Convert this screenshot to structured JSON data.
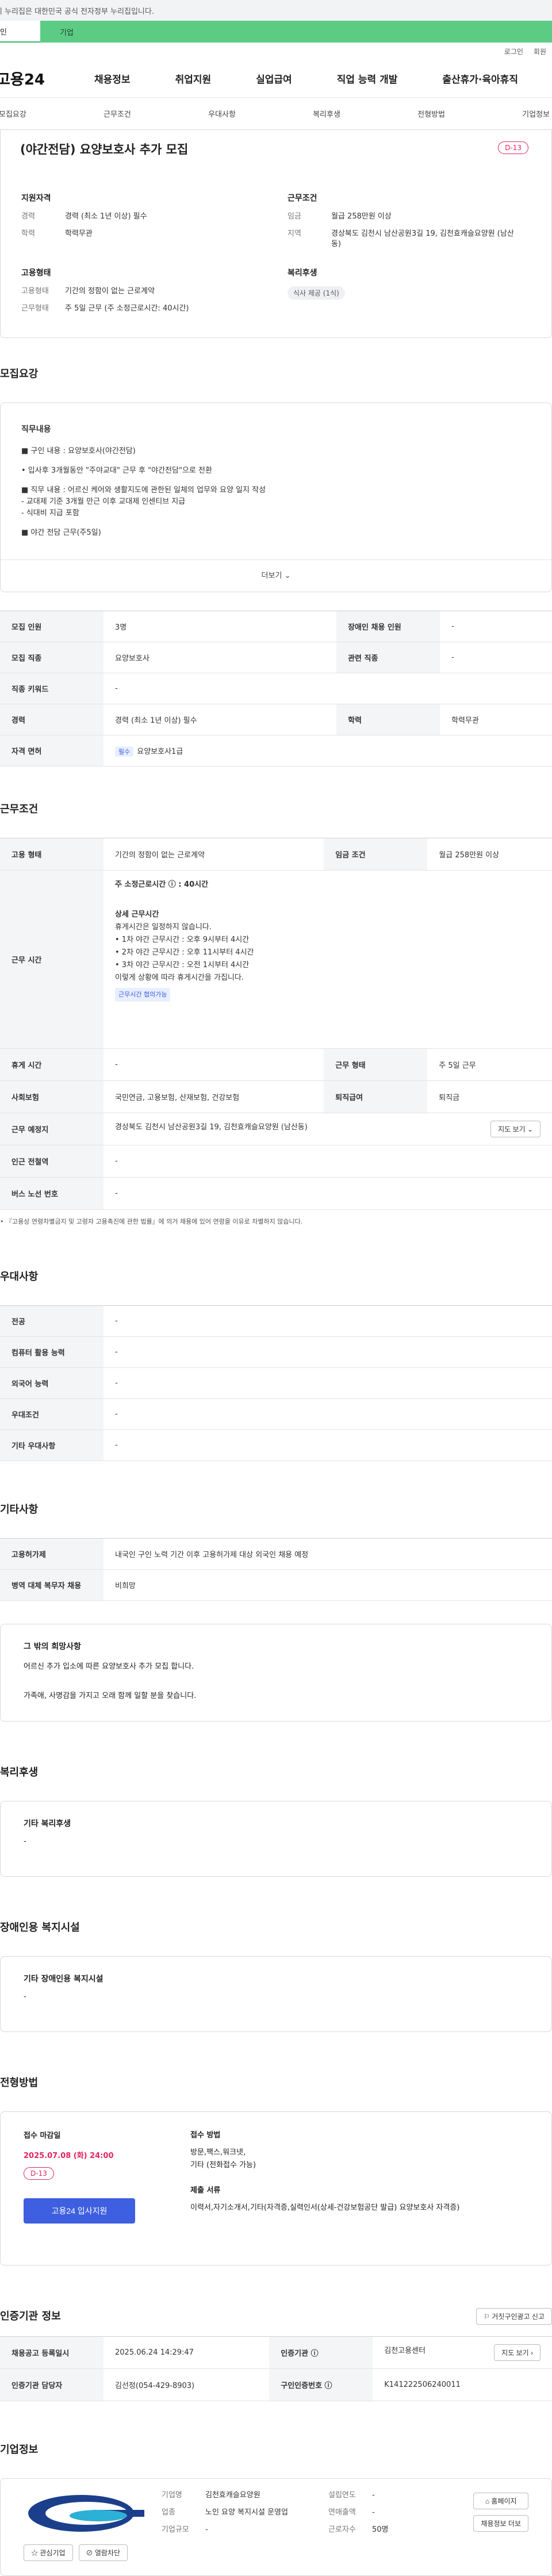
{
  "notice": "이 누리집은 대한민국 공식 전자정부 누리집입니다.",
  "tabs": [
    "인",
    "기업"
  ],
  "util": [
    "로그인",
    "회원"
  ],
  "logo": "고용24",
  "gnb": [
    "채용정보",
    "취업지원",
    "실업급여",
    "직업 능력 개발",
    "출산휴가·육아휴직"
  ],
  "anchors": [
    "모집요강",
    "근무조건",
    "우대사항",
    "복리후생",
    "전형방법",
    "기업정보"
  ],
  "summary": {
    "title": "(야간전담) 요양보호사 추가 모집",
    "dday": "D-13",
    "qual_title": "지원자격",
    "qual": [
      {
        "k": "경력",
        "v": "경력 (최소 1년 이상) 필수"
      },
      {
        "k": "학력",
        "v": "학력무관"
      }
    ],
    "cond_title": "근무조건",
    "cond": [
      {
        "k": "임금",
        "v": "월급 258만원 이상"
      },
      {
        "k": "지역",
        "v": "경상북도 김천시 남산공원3길 19, 김천효캐슬요양원 (남산동)"
      }
    ],
    "emp_title": "고용형태",
    "emp": [
      {
        "k": "고용형태",
        "v": "기간의 정함이 없는 근로계약"
      },
      {
        "k": "근무형태",
        "v": "주 5일 근무 (주 소정근로시간: 40시간)"
      }
    ],
    "welfare_title": "복리후생",
    "welfare_chip": "식사 제공 (1식)"
  },
  "req": {
    "title": "모집요강",
    "sub": "직무내용",
    "lines": [
      "■ 구인 내용 : 요양보호사(야간전담)",
      "• 입사후 3개월동안 \"주야교대\" 근무 후 \"야간전담\"으로 전환",
      "■ 직무 내용 : 어르신 케어와 생활지도에 관한된 일체의 업무와 요양 일지 작성\n- 교대제 기준 3개월 만근 이후 교대제 인센티브 지급\n- 식대비 지급 포함",
      "■ 야간 전담 근무(주5일)"
    ],
    "more": "더보기"
  },
  "req_table": [
    {
      "k": "모집 인원",
      "v": "3명",
      "k2": "장애인 채용 인원",
      "v2": "-"
    },
    {
      "k": "모집 직종",
      "v": "요양보호사",
      "k2": "관련 직종",
      "v2": "-"
    },
    {
      "k": "직종 키워드",
      "v": "-"
    },
    {
      "k": "경력",
      "v": "경력 (최소 1년 이상) 필수",
      "k2": "학력",
      "v2": "학력무관"
    },
    {
      "k": "자격 면허",
      "badge": "필수",
      "v": "요양보호사1급"
    }
  ],
  "work": {
    "title": "근무조건",
    "emp_k": "고용 형태",
    "emp_v": "기간의 정함이 없는 근로계약",
    "wage_k": "임금 조건",
    "wage_v": "월급 258만원 이상",
    "time_k": "근무 시간",
    "time_lines": [
      "주 소정근로시간 ⓘ : 40시간",
      "상세 근무시간",
      "휴게시간은 일정하지 않습니다.",
      "• 1차 야간 근무시간 : 오후 9시부터 4시간",
      "• 2차 야간 근무시간 : 오후 11시부터 4시간",
      "• 3차 야간 근무시간 : 오전 1시부터 4시간",
      "이렇게 상황에 따라 휴게시간을 가집니다."
    ],
    "time_tag": "근무시간 협의가능",
    "rows": [
      {
        "k": "휴게 시간",
        "v": "-",
        "k2": "근무 형태",
        "v2": "주 5일 근무"
      },
      {
        "k": "사회보험",
        "v": "국민연금, 고용보험, 산재보험, 건강보험",
        "k2": "퇴직급여",
        "v2": "퇴직금"
      },
      {
        "k": "근무 예정지",
        "v": "경상북도 김천시 남산공원3길 19, 김천효캐슬요양원 (남산동)",
        "btn": "지도 보기"
      },
      {
        "k": "인근 전철역",
        "v": "-"
      },
      {
        "k": "버스 노선 번호",
        "v": "-"
      }
    ],
    "note": "• 『고용상 연령차별금지 및 고령자 고용촉진에 관한 법률』에 의거 채용에 있어 연령을 이유로 차별하지 않습니다."
  },
  "pref": {
    "title": "우대사항",
    "rows": [
      {
        "k": "전공",
        "v": "-"
      },
      {
        "k": "컴퓨터 활용 능력",
        "v": "-"
      },
      {
        "k": "외국어 능력",
        "v": "-"
      },
      {
        "k": "우대조건",
        "v": "-"
      },
      {
        "k": "기타 우대사항",
        "v": "-"
      }
    ]
  },
  "etc": {
    "title": "기타사항",
    "rows": [
      {
        "k": "고용허가제",
        "v": "내국인 구인 노력 기간 이후 고용허가제 대상 외국인 채용 예정"
      },
      {
        "k": "병역 대체 복무자 채용",
        "v": "비희망"
      }
    ],
    "box_title": "그 밖의 희망사항",
    "box_lines": [
      "어르신 추가 입소에 따른 요양보호사 추가 모집 합니다.",
      "가족애, 사명감을 가지고 오래 함께 일할 분을 찾습니다."
    ]
  },
  "welfare": {
    "title": "복리후생",
    "sub": "기타 복리후생",
    "v": "-"
  },
  "disabled": {
    "title": "장애인용 복지시설",
    "sub": "기타 장애인용 복지시설",
    "v": "-"
  },
  "method": {
    "title": "전형방법",
    "deadline_k": "접수 마감일",
    "deadline_v": "2025.07.08 (화) 24:00",
    "dday": "D-13",
    "apply": "고용24 입사지원",
    "how_k": "접수 방법",
    "how_v": "방문,팩스,워크넷,\n기타 (전화접수 가능)",
    "docs_k": "제출 서류",
    "docs_v": "이력서,자기소개서,기타(자격증,실력인서(상세-건강보험공단 발급) 요양보호사 자격증)"
  },
  "cert": {
    "title": "인증기관 정보",
    "btn_report": "거짓구인광고 신고",
    "rows": [
      {
        "k": "채용공고 등록일시",
        "v": "2025.06.24 14:29:47",
        "k2": "인증기관 ⓘ",
        "v2": "김천고용센터",
        "btn": "지도 보기"
      },
      {
        "k": "인증기관 담당자",
        "v": "김선정(054-429-8903)",
        "k2": "구인인증번호 ⓘ",
        "v2": "K141222506240011"
      }
    ]
  },
  "company": {
    "title": "기업정보",
    "fav": "관심기업",
    "block": "열람차단",
    "rows": [
      {
        "k": "기업명",
        "v": "김천효캐슬요양원"
      },
      {
        "k": "업종",
        "v": "노인 요양 복지시설 운영업"
      },
      {
        "k": "기업규모",
        "v": "-"
      }
    ],
    "rows2": [
      {
        "k": "설립연도",
        "v": "-"
      },
      {
        "k": "연매출액",
        "v": "-"
      },
      {
        "k": "근로자수",
        "v": "50명"
      }
    ],
    "btn_home": "홈페이지",
    "btn_jobs": "채용정보 더보"
  }
}
